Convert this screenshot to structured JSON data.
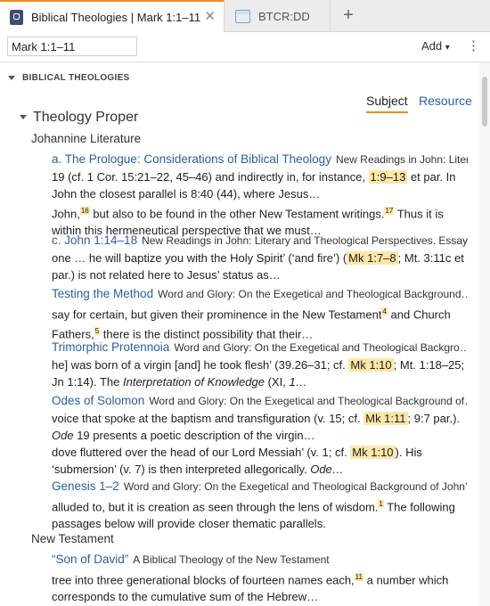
{
  "tabs": [
    {
      "label": "Biblical Theologies | Mark 1:1–11",
      "close": "✕"
    },
    {
      "label": "BTCR:DD"
    }
  ],
  "tab_add": "+",
  "toolbar": {
    "reference": "Mark 1:1–11",
    "add_label": "Add",
    "add_caret": "▾",
    "more": "⋮"
  },
  "section_title": "BIBLICAL THEOLOGIES",
  "sort": {
    "subject": "Subject",
    "resource": "Resource"
  },
  "heading": "Theology Proper",
  "groups": {
    "johannine": "Johannine Literature",
    "nt": "New Testament"
  },
  "entries": [
    {
      "title": "a. The Prologue: Considerations of Biblical Theology",
      "source": "New Readings in John: Liter…",
      "s1_a": "19 (cf. 1 Cor. 15:21–22, 45–46) and indirectly in, for instance, ",
      "s1_hl": "1:9–13",
      "s1_b": " et par. In John the closest parallel is 8:40 (44), where Jesus…",
      "s2_a": "John,",
      "s2_sup1": "16",
      "s2_b": " but also to be found in the other New Testament writings.",
      "s2_sup2": "17",
      "s2_c": " Thus it is within this hermeneutical perspective that we must…"
    },
    {
      "title": "c. John 1:14–18",
      "source": "New Readings in John: Literary and Theological Perspectives. Essay…",
      "s1_a": "one … he will baptize you with the Holy Spirit’ (‘and fire’) (",
      "s1_hl": "Mk 1:7–8",
      "s1_b": "; Mt. 3:11c et par.) is not related here to Jesus’ status as…"
    },
    {
      "title": "Testing the Method",
      "source": "Word and Glory: On the Exegetical and Theological Background…",
      "s1_a": "say for certain, but given their prominence in the New Testament",
      "s1_sup": "4",
      "s1_b": " and Church Fathers,",
      "s1_sup2": "5",
      "s1_c": " there is the distinct possibility that their…"
    },
    {
      "title": "Trimorphic Protennoia",
      "source": "Word and Glory: On the Exegetical and Theological Backgro…",
      "s1_a": "he] was born of a virgin [and] he took flesh’ (39.26–31; cf. ",
      "s1_hl": "Mk 1:10",
      "s1_b": "; Mt. 1:18–25; Jn 1:14). The ",
      "s1_i": "Interpretation of Knowledge",
      "s1_c": " (XI, ",
      "s1_i2": "1…"
    },
    {
      "title": "Odes of Solomon",
      "source": "Word and Glory: On the Exegetical and Theological Background of…",
      "s1_a": "voice that spoke at the baptism and transfiguration (v. 15; cf. ",
      "s1_hl": "Mk 1:11",
      "s1_b": "; 9:7 par.). ",
      "s1_i": "Ode",
      "s1_c": " 19 presents a poetic description of the virgin…",
      "s2_a": "dove fluttered over the head of our Lord Messiah’ (v. 1; cf. ",
      "s2_hl": "Mk 1:10",
      "s2_b": "). His ‘submersion’ (v. 7) is then interpreted allegorically. ",
      "s2_i": "Ode…"
    },
    {
      "title": "Genesis 1–2",
      "source": "Word and Glory: On the Exegetical and Theological Background of John’…",
      "s1_a": "alluded to, but it is creation as seen through the lens of wisdom.",
      "s1_sup": "1",
      "s1_b": " The following passages below will provide closer thematic parallels."
    },
    {
      "title": "“Son of David”",
      "source": "A Biblical Theology of the New Testament",
      "s1_a": "tree into three generational blocks of fourteen names each,",
      "s1_sup": "11",
      "s1_b": " a number which corresponds to the cumulative sum of the Hebrew…"
    }
  ],
  "colors": {
    "accent": "#f08a24",
    "link": "#2b5f9e",
    "highlight": "#fde6a6"
  }
}
